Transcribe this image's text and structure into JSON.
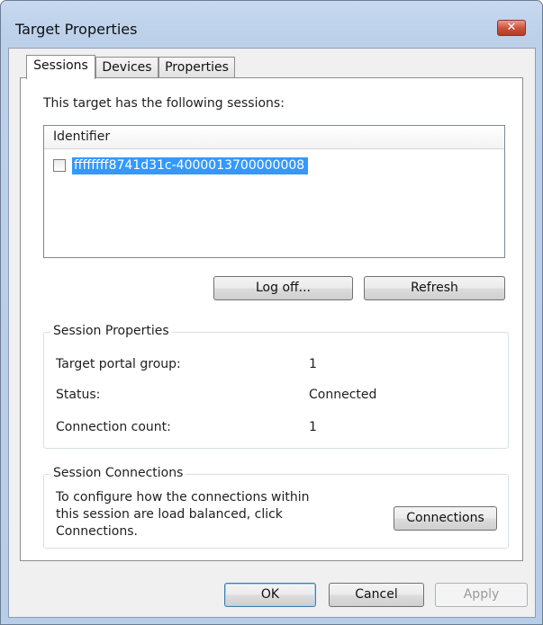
{
  "window": {
    "title": "Target Properties",
    "close_glyph": "✕"
  },
  "tabs": [
    {
      "label": "Sessions",
      "active": true
    },
    {
      "label": "Devices",
      "active": false
    },
    {
      "label": "Properties",
      "active": false
    }
  ],
  "sessions": {
    "intro": "This target has the following sessions:",
    "list_header": "Identifier",
    "items": [
      {
        "identifier": "ffffffff8741d31c-4000013700000008",
        "checked": false,
        "selected": true
      }
    ],
    "logoff_label": "Log off...",
    "refresh_label": "Refresh"
  },
  "session_properties": {
    "group_label": "Session Properties",
    "rows": [
      {
        "label": "Target portal group:",
        "value": "1"
      },
      {
        "label": "Status:",
        "value": "Connected"
      },
      {
        "label": "Connection count:",
        "value": "1"
      }
    ]
  },
  "session_connections": {
    "group_label": "Session Connections",
    "description_lines": [
      "To configure how the connections within",
      "this session are load balanced, click",
      "Connections."
    ],
    "button_label": "Connections"
  },
  "footer": {
    "ok_label": "OK",
    "cancel_label": "Cancel",
    "apply_label": "Apply",
    "apply_enabled": false
  },
  "colors": {
    "selection": "#3399ff",
    "title_bar": "#c6d9ef",
    "close_button": "#c9503b"
  }
}
